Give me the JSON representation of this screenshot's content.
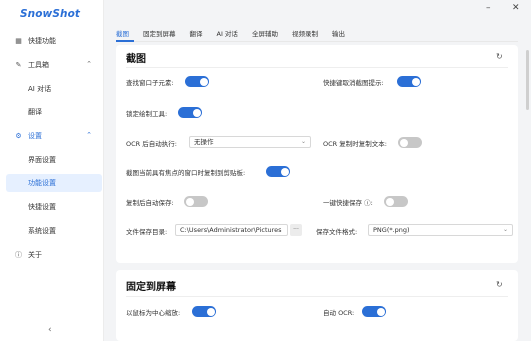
{
  "app": {
    "logo": "SnowShot"
  },
  "window": {
    "minimize": "–",
    "close": "✕"
  },
  "sidebar": {
    "items": [
      {
        "label": "快捷功能",
        "icon": "grid-icon",
        "glyph": "▦"
      },
      {
        "label": "工具箱",
        "icon": "wrench-icon",
        "glyph": "✎",
        "chevron": "⌃"
      },
      {
        "label": "AI 对话"
      },
      {
        "label": "翻译"
      },
      {
        "label": "设置",
        "icon": "gear-icon",
        "glyph": "⚙",
        "chevron": "⌃"
      },
      {
        "label": "界面设置"
      },
      {
        "label": "功能设置"
      },
      {
        "label": "快捷设置"
      },
      {
        "label": "系统设置"
      },
      {
        "label": "关于",
        "icon": "info-icon",
        "glyph": "ⓘ"
      }
    ],
    "collapse": "‹"
  },
  "tabs": [
    "截图",
    "固定到屏幕",
    "翻译",
    "AI 对话",
    "全屏辅助",
    "视频录制",
    "输出"
  ],
  "screenshot": {
    "title": "截图",
    "refresh": "↻",
    "find_children": "查找窗口子元素:",
    "shortcut_hint": "快捷键取消截图提示:",
    "lock_tool": "锁定绘制工具:",
    "ocr_after": "OCR 后自动执行:",
    "ocr_after_value": "无操作",
    "ocr_copy": "OCR 复制时复制文本:",
    "copy_focus": "截图当前具有焦点的窗口时复制到剪贴板:",
    "auto_save": "复制后自动保存:",
    "quick_save": "一键快捷保存 ⓘ:",
    "save_dir_label": "文件保存目录:",
    "save_dir_value": "C:\\Users\\Administrator\\Pictures",
    "save_dir_btn": "···",
    "save_format_label": "保存文件格式:",
    "save_format_value": "PNG(*.png)",
    "caret": "⌄"
  },
  "pin": {
    "title": "固定到屏幕",
    "refresh": "↻",
    "mouse_center_zoom": "以鼠标为中心缩放:",
    "auto_ocr": "自动 OCR:"
  },
  "colors": {
    "accent": "#2b6fd6",
    "toggle_off": "#c7c7c7"
  }
}
